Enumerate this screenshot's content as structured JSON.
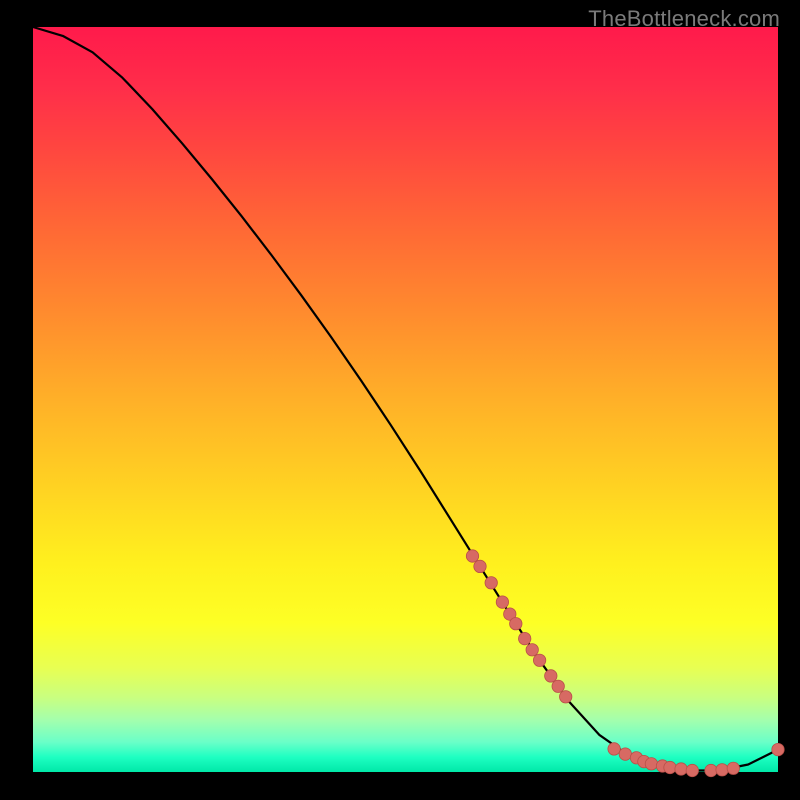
{
  "watermark": "TheBottleneck.com",
  "colors": {
    "curve": "#000000",
    "marker_fill": "#d76a63",
    "marker_stroke": "#b94f48",
    "background": "#000000"
  },
  "chart_data": {
    "type": "line",
    "title": "",
    "xlabel": "",
    "ylabel": "",
    "xlim": [
      0,
      100
    ],
    "ylim": [
      0,
      100
    ],
    "grid": false,
    "legend": false,
    "series": [
      {
        "name": "curve",
        "x": [
          0,
          4,
          8,
          12,
          16,
          20,
          24,
          28,
          32,
          36,
          40,
          44,
          48,
          52,
          56,
          60,
          64,
          68,
          72,
          76,
          80,
          84,
          88,
          92,
          96,
          100
        ],
        "y": [
          100,
          98.8,
          96.6,
          93.2,
          89.0,
          84.4,
          79.6,
          74.6,
          69.4,
          64.0,
          58.4,
          52.6,
          46.6,
          40.4,
          34.0,
          27.6,
          21.2,
          15.0,
          9.4,
          5.0,
          2.2,
          0.8,
          0.2,
          0.2,
          1.0,
          3.0
        ]
      }
    ],
    "markers": {
      "name": "highlighted-points",
      "x": [
        59,
        60,
        61.5,
        63,
        64,
        64.8,
        66,
        67,
        68,
        69.5,
        70.5,
        71.5,
        78,
        79.5,
        81,
        82,
        83,
        84.5,
        85.5,
        87,
        88.5,
        91,
        92.5,
        94,
        100
      ],
      "y": [
        29.0,
        27.6,
        25.4,
        22.8,
        21.2,
        19.9,
        17.9,
        16.4,
        15.0,
        12.9,
        11.5,
        10.1,
        3.1,
        2.4,
        1.9,
        1.4,
        1.1,
        0.8,
        0.6,
        0.4,
        0.2,
        0.2,
        0.3,
        0.5,
        3.0
      ]
    }
  }
}
